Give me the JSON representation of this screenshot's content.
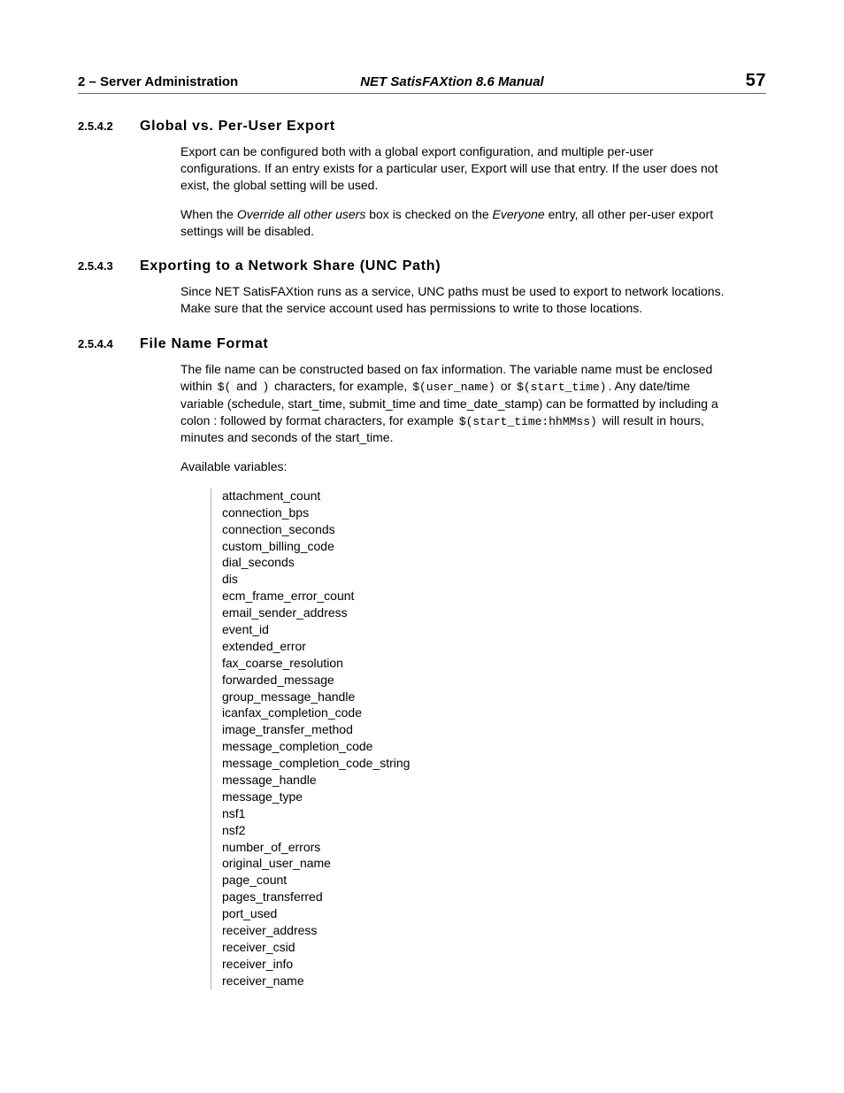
{
  "header": {
    "chapter_number": "2",
    "chapter_sep": "  –  ",
    "chapter_title": "Server Administration",
    "manual_title": "NET SatisFAXtion 8.6 Manual",
    "page_number": "57"
  },
  "sections": {
    "s1": {
      "num": "2.5.4.2",
      "title": "Global vs. Per-User Export",
      "p1": "Export can be configured both with a global export configuration, and multiple per-user configurations. If an entry exists for a particular user, Export will use that entry. If the user does not exist, the global setting will be used.",
      "p2_a": "When the ",
      "p2_i1": "Override all other users",
      "p2_b": " box is checked on the ",
      "p2_i2": "Everyone",
      "p2_c": " entry, all other per-user export settings will be disabled."
    },
    "s2": {
      "num": "2.5.4.3",
      "title": "Exporting to a Network Share (UNC Path)",
      "p1": "Since NET SatisFAXtion runs as a service, UNC paths must be used to export to network locations. Make sure that the service account used has permissions to write to those locations."
    },
    "s3": {
      "num": "2.5.4.4",
      "title": "File Name Format",
      "p1_a": "The file name can be constructed based on fax information. The variable name must be enclosed within ",
      "p1_m1": "$(",
      "p1_b": " and ",
      "p1_m2": ")",
      "p1_c": " characters, for example, ",
      "p1_m3": "$(user_name)",
      "p1_d": " or ",
      "p1_m4": "$(start_time)",
      "p1_e": ". Any date/time variable (schedule, start_time, submit_time and time_date_stamp) can be formatted by including a colon : followed by format characters, for example ",
      "p1_m5": "$(start_time:hhMMss)",
      "p1_f": " will result in hours, minutes and seconds of the start_time.",
      "p2": "Available variables:",
      "vars": [
        "attachment_count",
        "connection_bps",
        "connection_seconds",
        "custom_billing_code",
        "dial_seconds",
        "dis",
        "ecm_frame_error_count",
        "email_sender_address",
        "event_id",
        "extended_error",
        "fax_coarse_resolution",
        "forwarded_message",
        "group_message_handle",
        "icanfax_completion_code",
        "image_transfer_method",
        "message_completion_code",
        "message_completion_code_string",
        "message_handle",
        "message_type",
        "nsf1",
        "nsf2",
        "number_of_errors",
        "original_user_name",
        "page_count",
        "pages_transferred",
        "port_used",
        "receiver_address",
        "receiver_csid",
        "receiver_info",
        "receiver_name"
      ]
    }
  }
}
